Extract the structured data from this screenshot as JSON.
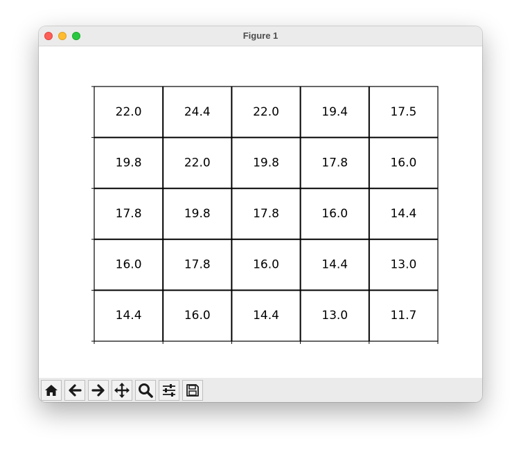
{
  "window": {
    "title": "Figure 1"
  },
  "toolbar": {
    "buttons": [
      {
        "name": "home-button",
        "icon": "home-icon"
      },
      {
        "name": "back-button",
        "icon": "arrow-left-icon"
      },
      {
        "name": "forward-button",
        "icon": "arrow-right-icon"
      },
      {
        "name": "pan-button",
        "icon": "move-icon"
      },
      {
        "name": "zoom-button",
        "icon": "magnifier-icon"
      },
      {
        "name": "configure-subplots-button",
        "icon": "sliders-icon"
      },
      {
        "name": "save-button",
        "icon": "floppy-disk-icon"
      }
    ]
  },
  "chart_data": {
    "type": "table",
    "rows": 5,
    "cols": 5,
    "values": [
      [
        "22.0",
        "24.4",
        "22.0",
        "19.4",
        "17.5"
      ],
      [
        "19.8",
        "22.0",
        "19.8",
        "17.8",
        "16.0"
      ],
      [
        "17.8",
        "19.8",
        "17.8",
        "16.0",
        "14.4"
      ],
      [
        "16.0",
        "17.8",
        "16.0",
        "14.4",
        "13.0"
      ],
      [
        "14.4",
        "16.0",
        "14.4",
        "13.0",
        "11.7"
      ]
    ],
    "title": "",
    "xlabel": "",
    "ylabel": "",
    "grid": true
  }
}
